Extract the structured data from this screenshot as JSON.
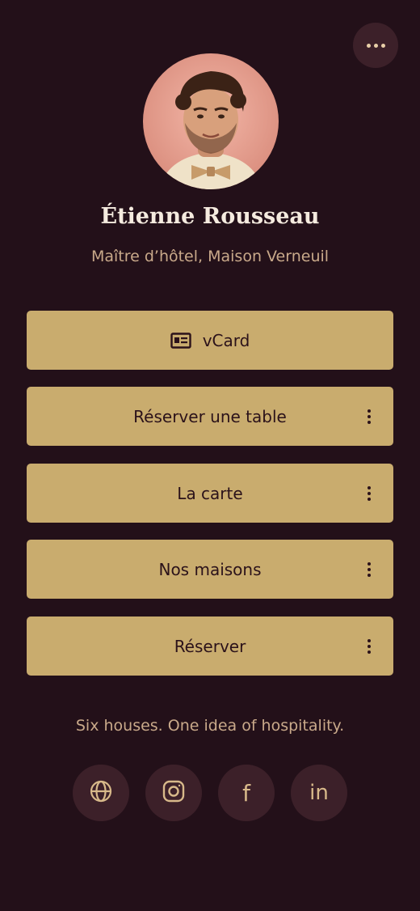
{
  "profile": {
    "name": "Étienne Rousseau",
    "subtitle": "Maître d’hôtel, Maison Verneuil"
  },
  "links": [
    {
      "label": "vCard",
      "icon": "id-card-icon"
    },
    {
      "label": "Réserver une table"
    },
    {
      "label": "La carte"
    },
    {
      "label": "Nos maisons"
    },
    {
      "label": "Réserver"
    }
  ],
  "tagline": "Six houses. One idea of hospitality.",
  "social": [
    {
      "icon": "globe-icon"
    },
    {
      "icon": "instagram-icon"
    },
    {
      "icon": "facebook-icon",
      "text": "f"
    },
    {
      "icon": "linkedin-icon",
      "text": "in"
    }
  ],
  "colors": {
    "background": "#231019",
    "button": "#c9ac6e",
    "button_text": "#2b121a",
    "name": "#f5ebdf",
    "muted_text": "#c9a98a",
    "circle": "#3c2029"
  }
}
